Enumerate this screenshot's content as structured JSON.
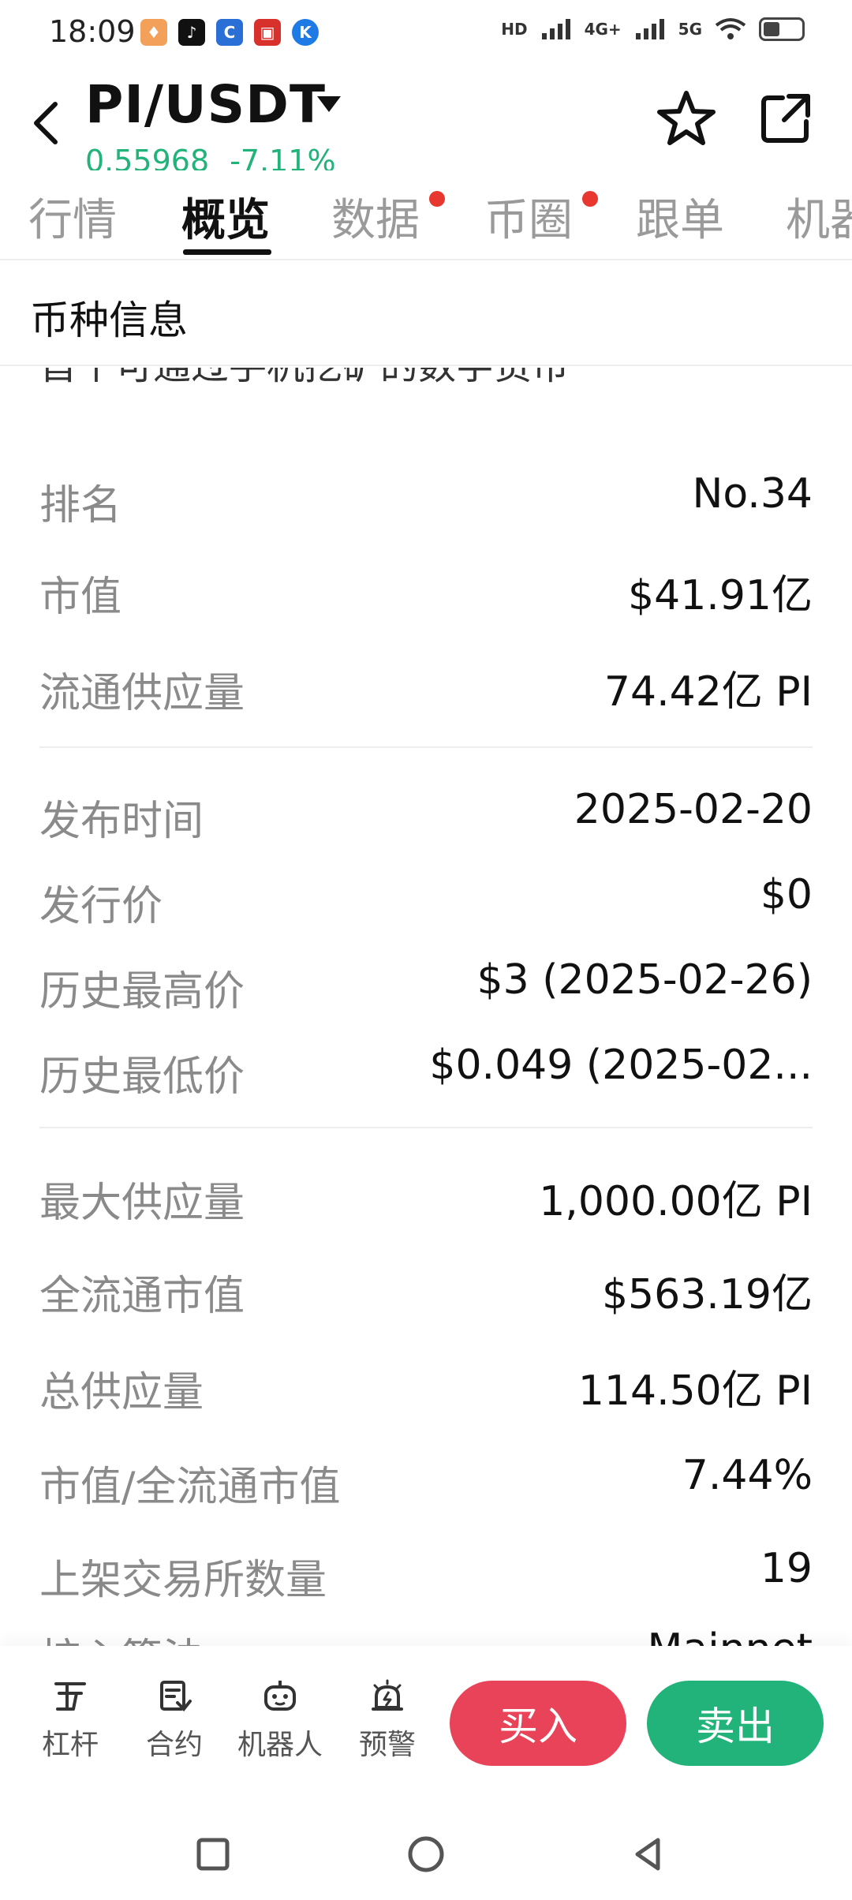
{
  "status_bar": {
    "time": "18:09",
    "network_labels": [
      "HD",
      "4G+",
      "5G"
    ],
    "app_icons": [
      "notification-app-icon",
      "tiktok-icon",
      "bank-app-icon",
      "shopping-app-icon",
      "k-app-icon"
    ]
  },
  "header": {
    "pair": "PI/USDT",
    "price": "0.55968",
    "change": "-7.11%"
  },
  "tabs": [
    {
      "label": "行情",
      "active": false,
      "dot": false
    },
    {
      "label": "概览",
      "active": true,
      "dot": false
    },
    {
      "label": "数据",
      "active": false,
      "dot": true
    },
    {
      "label": "币圈",
      "active": false,
      "dot": true
    },
    {
      "label": "跟单",
      "active": false,
      "dot": false
    },
    {
      "label": "机器",
      "active": false,
      "dot": false
    }
  ],
  "section": {
    "title": "币种信息",
    "description_tail": "首个可通过手机挖矿的数字货币"
  },
  "info_rows": [
    {
      "label": "排名",
      "value": "No.34"
    },
    {
      "label": "市值",
      "value": "$41.91亿"
    },
    {
      "label": "流通供应量",
      "value": "74.42亿 PI"
    },
    {
      "label": "发布时间",
      "value": "2025-02-20"
    },
    {
      "label": "发行价",
      "value": "$0"
    },
    {
      "label": "历史最高价",
      "value": "$3 (2025-02-26)"
    },
    {
      "label": "历史最低价",
      "value": "$0.049 (2025-02..."
    },
    {
      "label": "最大供应量",
      "value": "1,000.00亿 PI"
    },
    {
      "label": "全流通市值",
      "value": "$563.19亿"
    },
    {
      "label": "总供应量",
      "value": "114.50亿 PI"
    },
    {
      "label": "市值/全流通市值",
      "value": "7.44%"
    },
    {
      "label": "上架交易所数量",
      "value": "19"
    },
    {
      "label": "核心算法",
      "value": "Mainnet"
    }
  ],
  "toolbar": {
    "leverage": "杠杆",
    "contract": "合约",
    "bot": "机器人",
    "alert": "预警",
    "buy": "买入",
    "sell": "卖出"
  },
  "colors": {
    "up_green": "#22b37a",
    "sell_green": "#22b37a",
    "buy_red": "#e84358",
    "dot_red": "#e8372f"
  }
}
